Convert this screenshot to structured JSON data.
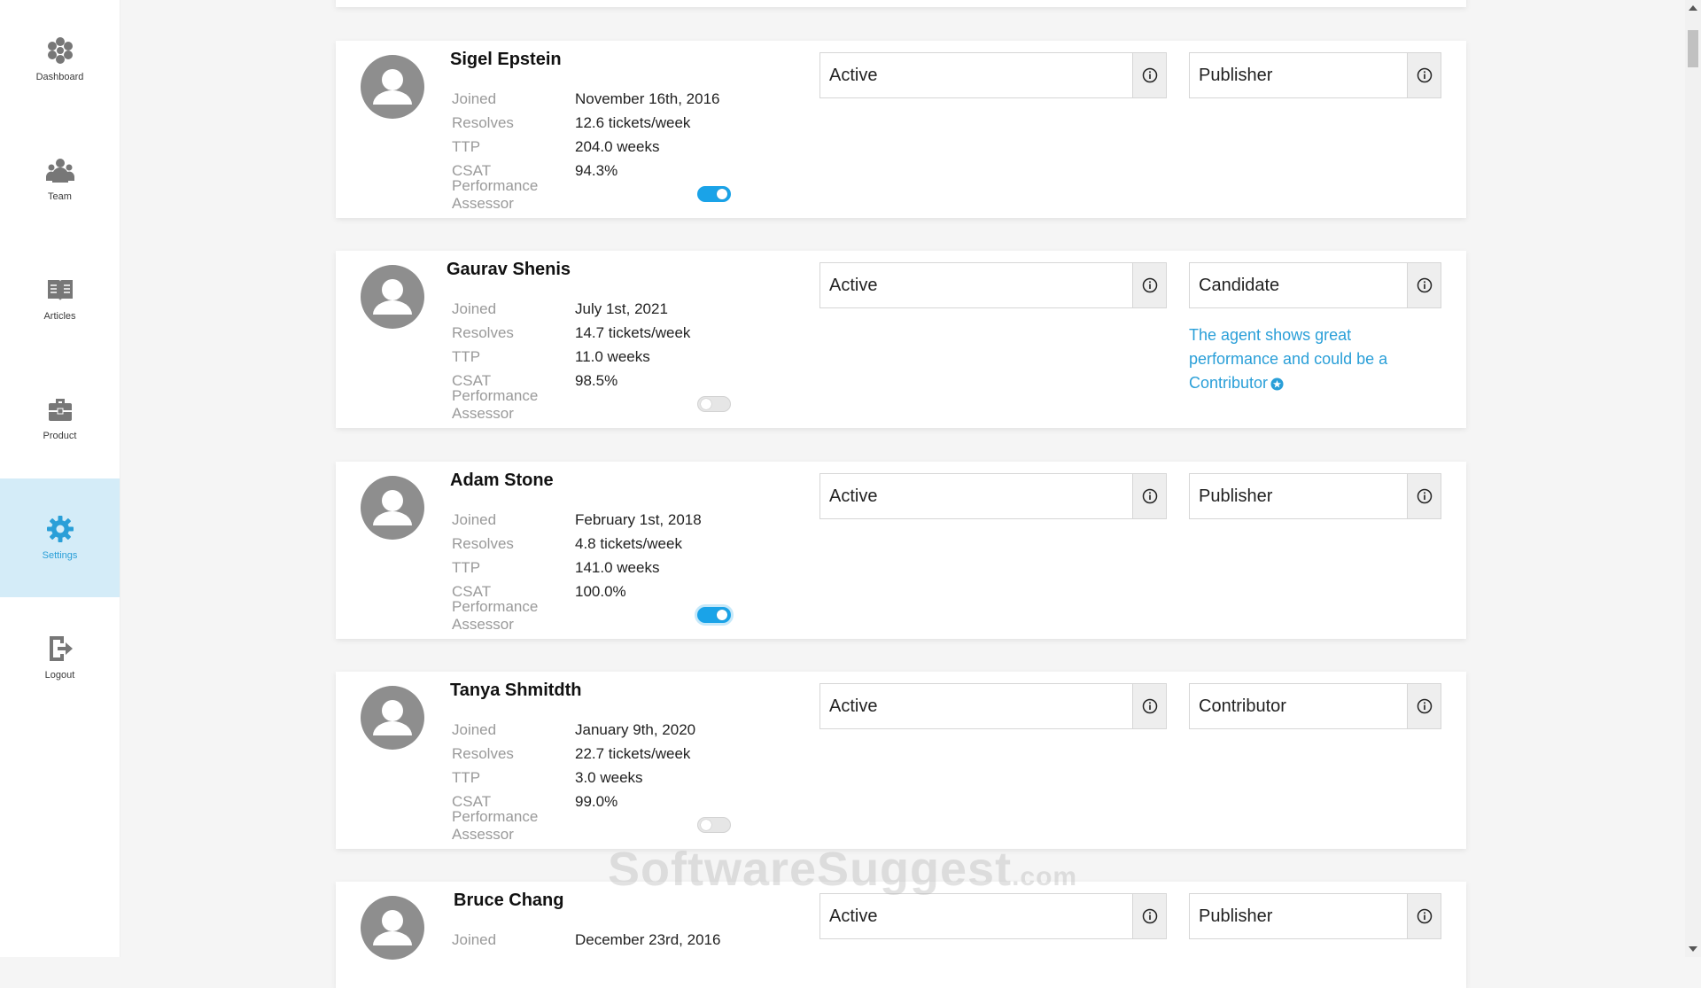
{
  "sidebar": {
    "items": [
      {
        "label": "Dashboard",
        "icon": "dashboard-icon"
      },
      {
        "label": "Team",
        "icon": "team-icon"
      },
      {
        "label": "Articles",
        "icon": "articles-icon"
      },
      {
        "label": "Product",
        "icon": "product-icon"
      },
      {
        "label": "Settings",
        "icon": "settings-icon",
        "active": true
      },
      {
        "label": "Logout",
        "icon": "logout-icon"
      }
    ]
  },
  "labels": {
    "joined": "Joined",
    "resolves": "Resolves",
    "ttp": "TTP",
    "csat": "CSAT",
    "assessor": "Performance Assessor"
  },
  "agents": [
    {
      "name": "Sigel Epstein",
      "joined": "November 16th, 2016",
      "resolves": "12.6 tickets/week",
      "ttp": "204.0 weeks",
      "csat": "94.3%",
      "assessor": true,
      "status": "Active",
      "role": "Publisher"
    },
    {
      "name": "Gaurav Shenis",
      "joined": "July 1st, 2021",
      "resolves": "14.7 tickets/week",
      "ttp": "11.0 weeks",
      "csat": "98.5%",
      "assessor": false,
      "status": "Active",
      "role": "Candidate",
      "suggestion": "The agent shows great performance and could be a Contributor"
    },
    {
      "name": "Adam Stone",
      "joined": "February 1st, 2018",
      "resolves": "4.8 tickets/week",
      "ttp": "141.0 weeks",
      "csat": "100.0%",
      "assessor": true,
      "status": "Active",
      "role": "Publisher"
    },
    {
      "name": "Tanya Shmitdth",
      "joined": "January 9th, 2020",
      "resolves": "22.7 tickets/week",
      "ttp": "3.0 weeks",
      "csat": "99.0%",
      "assessor": false,
      "status": "Active",
      "role": "Contributor"
    },
    {
      "name": "Bruce Chang",
      "joined": "December 23rd, 2016",
      "status": "Active",
      "role": "Publisher"
    }
  ],
  "watermark": {
    "main": "SoftwareSuggest",
    "suffix": ".com"
  },
  "colors": {
    "accent": "#2a9fd8",
    "toggle_on": "#1aa3e8",
    "active_nav_bg": "#d4ecf8"
  }
}
